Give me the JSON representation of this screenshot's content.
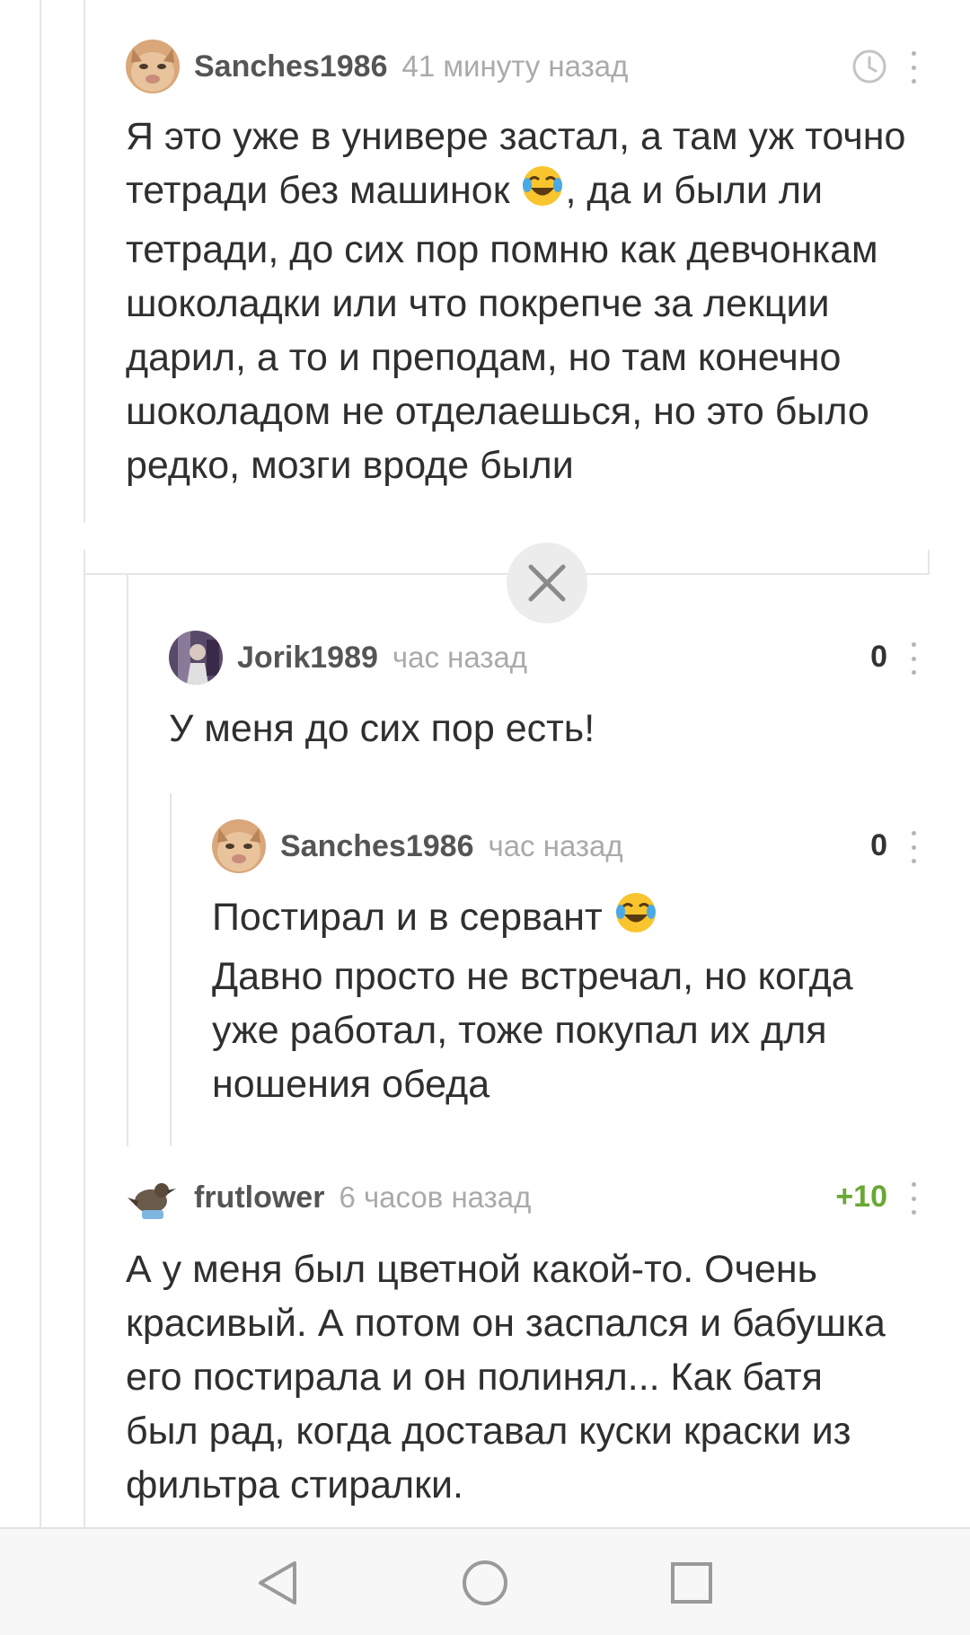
{
  "comments": [
    {
      "author": "Sanches1986",
      "time": "41 минуту назад",
      "text_a": "Я это уже в универе застал, а там уж точно\nтетради без машинок ",
      "text_b": ", да и были ли\nтетради, до сих пор помню как девчонкам\nшоколадки или что покрепче за лекции\nдарил, а то и преподам, но там конечно\nшоколадом не отделаешься, но это было\nредко, мозги вроде были",
      "avatar_icon": "cat-avatar",
      "side_icon": "clock-icon"
    },
    {
      "author": "Jorik1989",
      "time": "час назад",
      "rating": "0",
      "text": "У меня до сих пор есть!",
      "avatar_icon": "person-avatar"
    },
    {
      "author": "Sanches1986",
      "time": "час назад",
      "rating": "0",
      "text_a": "Постирал и в сервант ",
      "text_b": "\nДавно просто не встречал, но когда\nуже работал, тоже покупал их для\nношения обеда",
      "avatar_icon": "cat-avatar"
    },
    {
      "author": "frutlower",
      "time": "6 часов назад",
      "rating": "+10",
      "text": "А у меня был цветной какой-то. Очень\nкрасивый. А потом он заспался и бабушка\nего постирала и он полинял... Как батя\nбыл рад, когда доставал куски краски из\nфильтра стиралки.",
      "avatar_icon": "bird-avatar"
    }
  ],
  "icons": {
    "emoji": "face-with-tears-of-joy",
    "collapse": "close-icon",
    "menu": "more-vertical-icon",
    "nav_back": "triangle-back-icon",
    "nav_home": "circle-home-icon",
    "nav_recent": "square-recent-icon"
  },
  "colors": {
    "positive_rating": "#6aa834",
    "muted_text": "#aaaaaa",
    "thread_line": "#e6e6e6"
  }
}
